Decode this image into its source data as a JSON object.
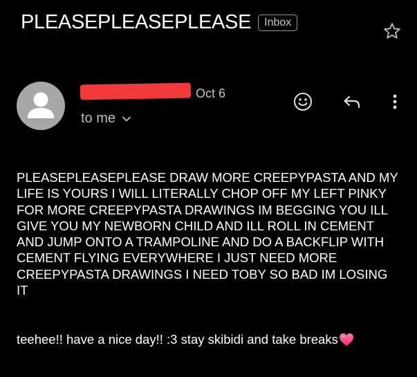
{
  "email": {
    "subject": "PLEASEPLEASEPLEASE",
    "label": "Inbox",
    "date": "Oct 6",
    "recipient": "to me",
    "body": "PLEASEPLEASEPLEASE DRAW MORE CREEPYPASTA AND MY\nLIFE IS YOURS I WILL LITERALLY CHOP OFF MY LEFT PINKY\nFOR MORE CREEPYPASTA DRAWINGS IM BEGGING YOU ILL\nGIVE YOU MY NEWBORN CHILD AND ILL ROLL IN CEMENT\nAND JUMP ONTO A TRAMPOLINE AND DO A BACKFLIP WITH\nCEMENT FLYING EVERYWHERE I JUST NEED MORE\nCREEPYPASTA DRAWINGS I NEED TOBY SO BAD IM LOSING\nIT",
    "closing": "teehee!! have a nice day!! :3 stay skibidi and take breaks"
  },
  "icons": {
    "star": "star-icon",
    "avatar": "person-icon",
    "expand": "chevron-down-icon",
    "react": "smiley-icon",
    "reply": "reply-icon",
    "more": "more-vert-icon",
    "heart": "heart-icon",
    "redaction": "red-redaction-mark"
  },
  "colors": {
    "background": "#000000",
    "text": "#ffffff",
    "secondary_text": "#bdbdbd",
    "avatar_bg": "#a7a7a7",
    "redaction": "#f23a3a",
    "heart": "#f0417a"
  }
}
